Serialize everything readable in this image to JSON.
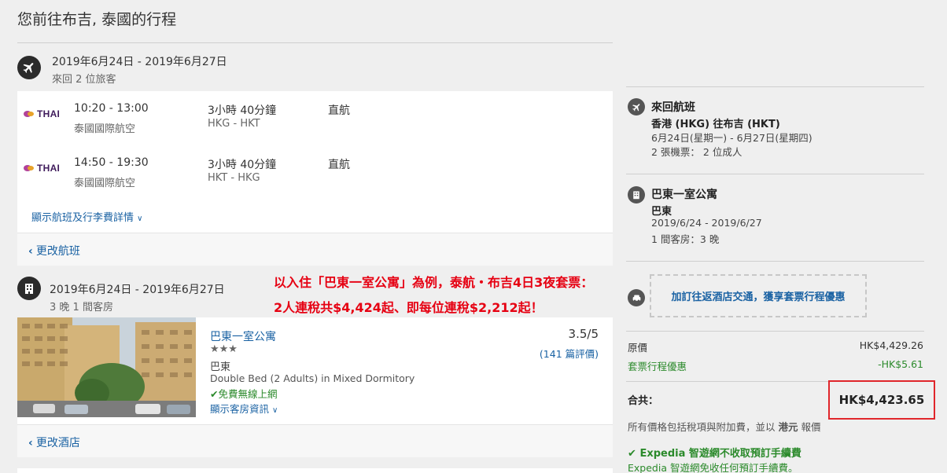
{
  "page": {
    "title": "您前往布吉, 泰國的行程"
  },
  "flight_section": {
    "dates": "2019年6月24日 - 2019年6月27日",
    "trip_info": "來回   2 位旅客",
    "legs": [
      {
        "airline_logo": "THAI",
        "times": "10:20 - 13:00",
        "airline": "泰國國際航空",
        "duration": "3小時 40分鐘",
        "route": "HKG - HKT",
        "stops": "直航"
      },
      {
        "airline_logo": "THAI",
        "times": "14:50 - 19:30",
        "airline": "泰國國際航空",
        "duration": "3小時 40分鐘",
        "route": "HKT - HKG",
        "stops": "直航"
      }
    ],
    "details_link": "顯示航班及行李費詳情",
    "change_link": "更改航班"
  },
  "hotel_section": {
    "dates": "2019年6月24日 - 2019年6月27日",
    "stay_info": "3 晚   1 間客房",
    "name": "巴東一室公寓",
    "stars": "★★★",
    "area": "巴東",
    "room": "Double Bed (2 Adults) in Mixed Dormitory",
    "wifi": "免費無線上網",
    "room_link": "顯示客房資訊",
    "rating": "3.5/5",
    "reviews": "(141 篇評價)",
    "change_link": "更改酒店"
  },
  "annotation": {
    "line1": "以入住「巴東一室公寓」為例，泰航・布吉4日3夜套票：",
    "line2": "2人連稅共$4,424起、即每位連稅$2,212起！"
  },
  "summary": {
    "flight": {
      "title": "來回航班",
      "route": "香港 (HKG) 往布吉 (HKT)",
      "dates": "6月24日(星期一) - 6月27日(星期四)",
      "tickets": "2 張機票： 2 位成人"
    },
    "hotel": {
      "title": "巴東一室公寓",
      "area": "巴東",
      "dates": "2019/6/24 - 2019/6/27",
      "rooms": "1 間客房：3 晚"
    },
    "promo": "加訂往返酒店交通，獲享套票行程優惠",
    "original_label": "原價",
    "original_value": "HK$4,429.26",
    "discount_label": "套票行程優惠",
    "discount_value": "-HK$5.61",
    "total_label": "合共：",
    "total_value": "HK$4,423.65",
    "tax_note_1": "所有價格包括稅項與附加費，並以",
    "currency": "港元",
    "tax_note_2": "報價",
    "fee_title": "Expedia 智遊網不收取預訂手續費",
    "fee_sub": "Expedia 智遊網免收任何預訂手續費。"
  },
  "colors": {
    "link": "#1a62a3",
    "red": "#e60012",
    "green": "#2b8a2b",
    "thai": "#3f1b5b"
  }
}
